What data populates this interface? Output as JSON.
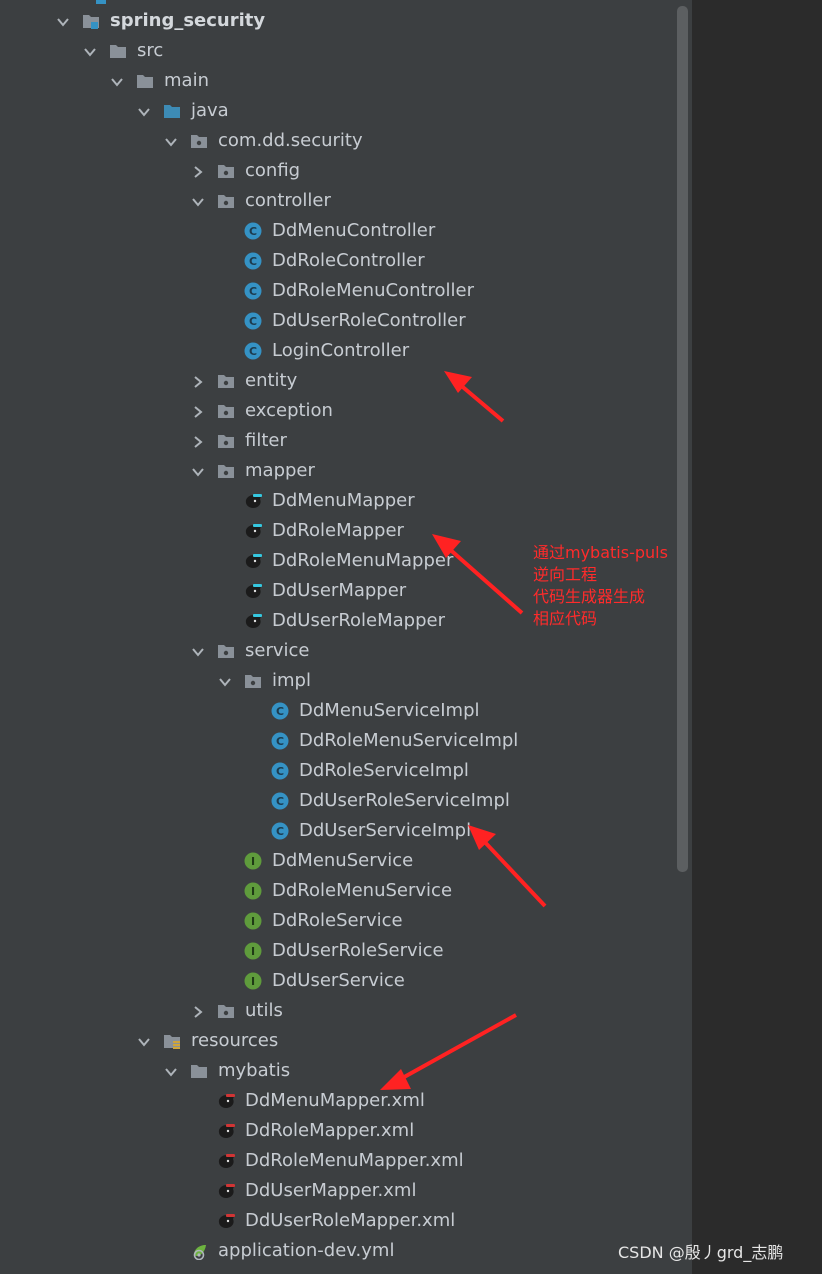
{
  "tree": [
    {
      "label": "spring_security",
      "depth": 0,
      "expanded": true,
      "icon": "module-folder-icon",
      "bold": true
    },
    {
      "label": "src",
      "depth": 1,
      "expanded": true,
      "icon": "folder-icon"
    },
    {
      "label": "main",
      "depth": 2,
      "expanded": true,
      "icon": "folder-icon"
    },
    {
      "label": "java",
      "depth": 3,
      "expanded": true,
      "icon": "source-folder-icon"
    },
    {
      "label": "com.dd.security",
      "depth": 4,
      "expanded": true,
      "icon": "package-icon"
    },
    {
      "label": "config",
      "depth": 5,
      "expanded": false,
      "icon": "package-icon"
    },
    {
      "label": "controller",
      "depth": 5,
      "expanded": true,
      "icon": "package-icon"
    },
    {
      "label": "DdMenuController",
      "depth": 6,
      "icon": "class-icon"
    },
    {
      "label": "DdRoleController",
      "depth": 6,
      "icon": "class-icon"
    },
    {
      "label": "DdRoleMenuController",
      "depth": 6,
      "icon": "class-icon"
    },
    {
      "label": "DdUserRoleController",
      "depth": 6,
      "icon": "class-icon"
    },
    {
      "label": "LoginController",
      "depth": 6,
      "icon": "class-icon"
    },
    {
      "label": "entity",
      "depth": 5,
      "expanded": false,
      "icon": "package-icon"
    },
    {
      "label": "exception",
      "depth": 5,
      "expanded": false,
      "icon": "package-icon"
    },
    {
      "label": "filter",
      "depth": 5,
      "expanded": false,
      "icon": "package-icon"
    },
    {
      "label": "mapper",
      "depth": 5,
      "expanded": true,
      "icon": "package-icon"
    },
    {
      "label": "DdMenuMapper",
      "depth": 6,
      "icon": "mybatis-mapper-icon"
    },
    {
      "label": "DdRoleMapper",
      "depth": 6,
      "icon": "mybatis-mapper-icon"
    },
    {
      "label": "DdRoleMenuMapper",
      "depth": 6,
      "icon": "mybatis-mapper-icon"
    },
    {
      "label": "DdUserMapper",
      "depth": 6,
      "icon": "mybatis-mapper-icon"
    },
    {
      "label": "DdUserRoleMapper",
      "depth": 6,
      "icon": "mybatis-mapper-icon"
    },
    {
      "label": "service",
      "depth": 5,
      "expanded": true,
      "icon": "package-icon"
    },
    {
      "label": "impl",
      "depth": 6,
      "expanded": true,
      "icon": "package-icon"
    },
    {
      "label": "DdMenuServiceImpl",
      "depth": 7,
      "icon": "class-icon"
    },
    {
      "label": "DdRoleMenuServiceImpl",
      "depth": 7,
      "icon": "class-icon"
    },
    {
      "label": "DdRoleServiceImpl",
      "depth": 7,
      "icon": "class-icon"
    },
    {
      "label": "DdUserRoleServiceImpl",
      "depth": 7,
      "icon": "class-icon"
    },
    {
      "label": "DdUserServiceImpl",
      "depth": 7,
      "icon": "class-icon"
    },
    {
      "label": "DdMenuService",
      "depth": 6,
      "icon": "interface-icon"
    },
    {
      "label": "DdRoleMenuService",
      "depth": 6,
      "icon": "interface-icon"
    },
    {
      "label": "DdRoleService",
      "depth": 6,
      "icon": "interface-icon"
    },
    {
      "label": "DdUserRoleService",
      "depth": 6,
      "icon": "interface-icon"
    },
    {
      "label": "DdUserService",
      "depth": 6,
      "icon": "interface-icon"
    },
    {
      "label": "utils",
      "depth": 5,
      "expanded": false,
      "icon": "package-icon"
    },
    {
      "label": "resources",
      "depth": 3,
      "expanded": true,
      "icon": "resources-folder-icon"
    },
    {
      "label": "mybatis",
      "depth": 4,
      "expanded": true,
      "icon": "folder-icon"
    },
    {
      "label": "DdMenuMapper.xml",
      "depth": 5,
      "icon": "mybatis-xml-icon"
    },
    {
      "label": "DdRoleMapper.xml",
      "depth": 5,
      "icon": "mybatis-xml-icon"
    },
    {
      "label": "DdRoleMenuMapper.xml",
      "depth": 5,
      "icon": "mybatis-xml-icon"
    },
    {
      "label": "DdUserMapper.xml",
      "depth": 5,
      "icon": "mybatis-xml-icon"
    },
    {
      "label": "DdUserRoleMapper.xml",
      "depth": 5,
      "icon": "mybatis-xml-icon"
    },
    {
      "label": "application-dev.yml",
      "depth": 4,
      "icon": "spring-yml-icon"
    }
  ],
  "annotation": {
    "lines": [
      "通过mybatis-puls",
      "逆向工程",
      "代码生成器生成",
      "相应代码"
    ]
  },
  "watermark": "CSDN @殷丿grd_志鹏",
  "colors": {
    "panel_bg": "#3c3f41",
    "editor_bg": "#2b2b2b",
    "text": "#c7ccd2",
    "class_icon": "#3592c4",
    "interface_icon": "#5f9b3c",
    "annotation": "#ff2b2b"
  }
}
